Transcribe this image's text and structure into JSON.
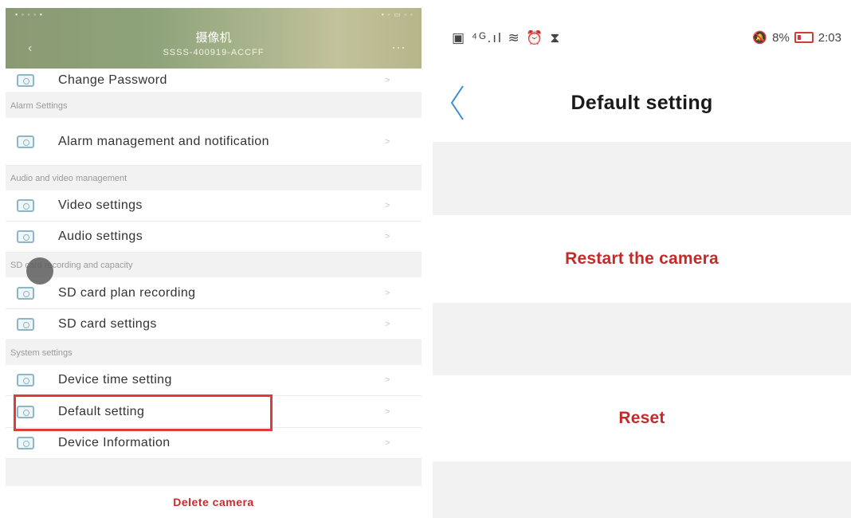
{
  "left_screen": {
    "header": {
      "title": "摄像机",
      "subtitle": "SSSS-400919-ACCFF"
    },
    "rows": [
      {
        "label": "Change Password"
      },
      {
        "label": "Alarm management and notification"
      },
      {
        "label": "Video settings"
      },
      {
        "label": "Audio settings"
      },
      {
        "label": "SD card plan recording"
      },
      {
        "label": "SD card settings"
      },
      {
        "label": "Device time setting"
      },
      {
        "label": "Default setting"
      },
      {
        "label": "Device Information"
      }
    ],
    "sections": {
      "alarm": "Alarm Settings",
      "av": "Audio and video management",
      "sd": "SD card recording and capacity",
      "system": "System settings"
    },
    "delete_label": "Delete camera",
    "highlight_color": "#e03b3b"
  },
  "right_screen": {
    "status_bar": {
      "left_icons": "▣ ⁴ᴳ.ıl ≋ ⏰ ⧗",
      "battery_percent": "8%",
      "time": "2:03"
    },
    "title": "Default setting",
    "actions": {
      "restart": "Restart the camera",
      "reset": "Reset"
    },
    "accent_color": "#c42a2a",
    "back_color": "#3d8fd6"
  }
}
